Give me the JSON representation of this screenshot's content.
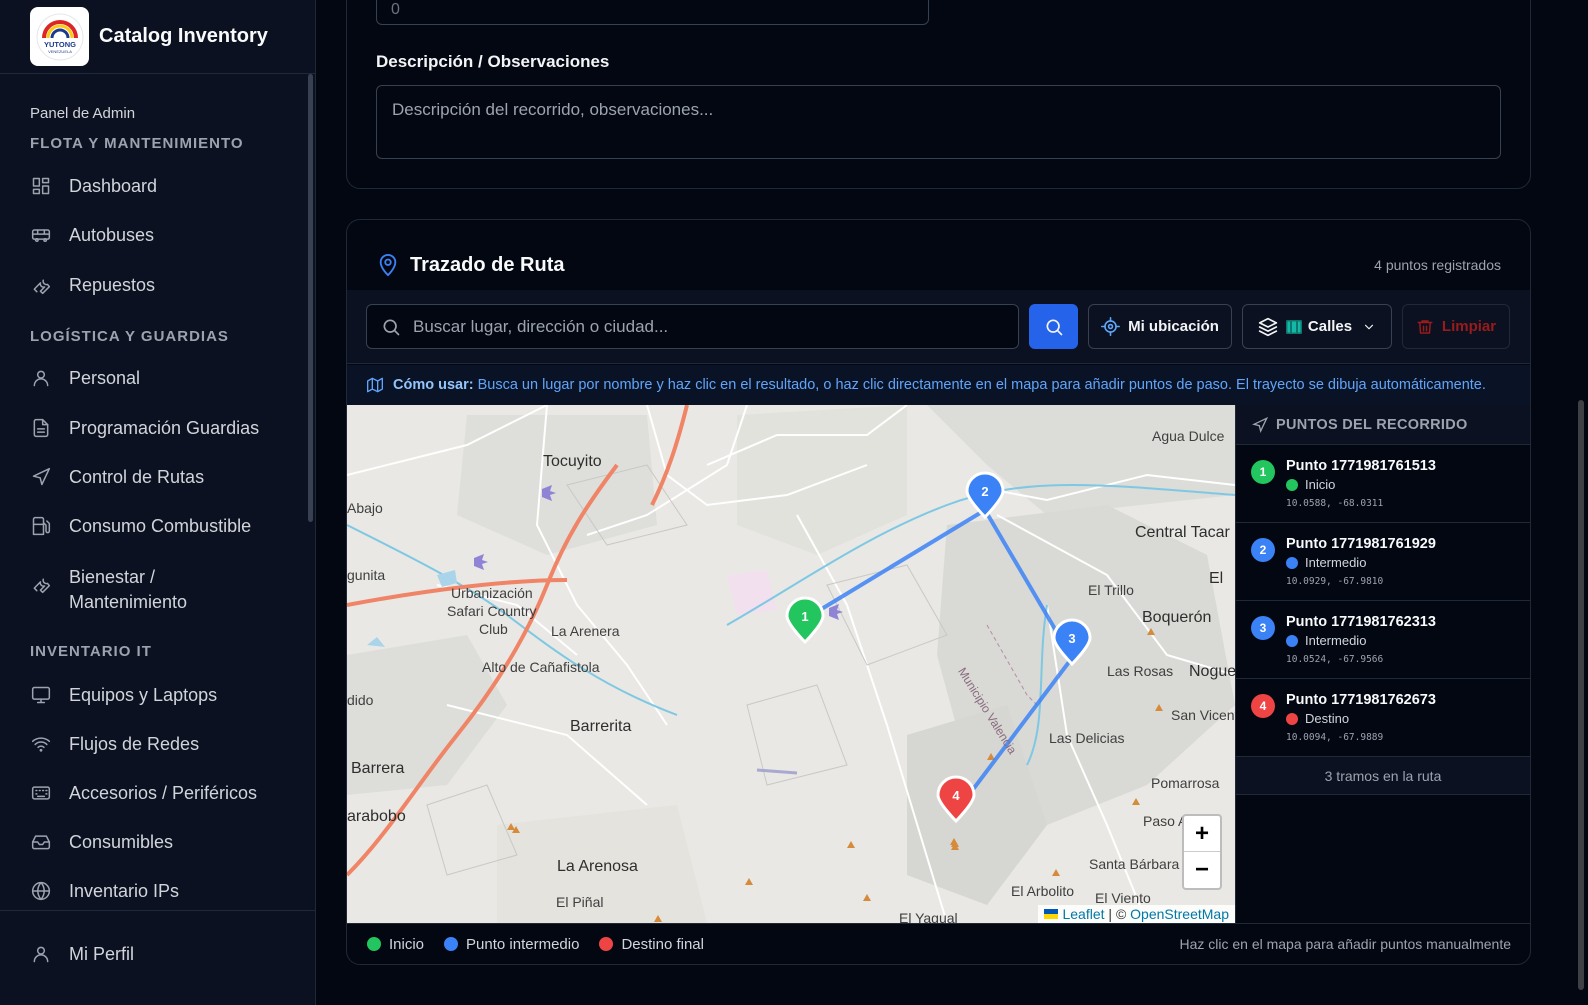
{
  "app": {
    "title": "Catalog Inventory",
    "logo_icon": "yutong-logo"
  },
  "sidebar": {
    "panel_label": "Panel de Admin",
    "sections": [
      {
        "label": "FLOTA Y MANTENIMIENTO",
        "items": [
          {
            "label": "Dashboard",
            "icon": "dashboard-icon"
          },
          {
            "label": "Autobuses",
            "icon": "bus-icon"
          },
          {
            "label": "Repuestos",
            "icon": "wrench-icon"
          }
        ]
      },
      {
        "label": "LOGÍSTICA Y GUARDIAS",
        "items": [
          {
            "label": "Personal",
            "icon": "user-icon"
          },
          {
            "label": "Programación Guardias",
            "icon": "document-icon"
          },
          {
            "label": "Control de Rutas",
            "icon": "navigation-icon"
          },
          {
            "label": "Consumo Combustible",
            "icon": "fuel-icon"
          },
          {
            "label": "Bienestar / Mantenimiento",
            "line1": "Bienestar /",
            "line2": "Mantenimiento",
            "icon": "wrench-icon"
          }
        ]
      },
      {
        "label": "INVENTARIO IT",
        "items": [
          {
            "label": "Equipos y Laptops",
            "icon": "monitor-icon"
          },
          {
            "label": "Flujos de Redes",
            "icon": "wifi-icon"
          },
          {
            "label": "Accesorios / Periféricos",
            "icon": "keyboard-icon"
          },
          {
            "label": "Consumibles",
            "icon": "inbox-icon"
          },
          {
            "label": "Inventario IPs",
            "icon": "globe-icon"
          }
        ]
      }
    ],
    "footer": {
      "label": "Mi Perfil",
      "icon": "user-icon"
    }
  },
  "form": {
    "top_input_value": "0",
    "description_label": "Descripción / Observaciones",
    "description_placeholder": "Descripción del recorrido, observaciones..."
  },
  "route": {
    "title": "Trazado de Ruta",
    "count_text": "4 puntos registrados",
    "search_placeholder": "Buscar lugar, dirección o ciudad...",
    "my_location_label": "Mi ubicación",
    "layer_label": "Calles",
    "clear_label": "Limpiar",
    "help_title": "Cómo usar:",
    "help_text": "Busca un lugar por nombre y haz clic en el resultado, o haz clic directamente en el mapa para añadir puntos de paso. El trayecto se dibuja automáticamente.",
    "points_header": "PUNTOS DEL RECORRIDO",
    "points": [
      {
        "num": "1",
        "name": "Punto 1771981761513",
        "role": "Inicio",
        "coords": "10.0588, -68.0311",
        "color": "#22c55e"
      },
      {
        "num": "2",
        "name": "Punto 1771981761929",
        "role": "Intermedio",
        "coords": "10.0929, -67.9810",
        "color": "#3b82f6"
      },
      {
        "num": "3",
        "name": "Punto 1771981762313",
        "role": "Intermedio",
        "coords": "10.0524, -67.9566",
        "color": "#3b82f6"
      },
      {
        "num": "4",
        "name": "Punto 1771981762673",
        "role": "Destino",
        "coords": "10.0094, -67.9889",
        "color": "#ef4444"
      }
    ],
    "segments_text": "3 tramos en la ruta",
    "legend": [
      {
        "label": "Inicio",
        "color": "#22c55e"
      },
      {
        "label": "Punto intermedio",
        "color": "#3b82f6"
      },
      {
        "label": "Destino final",
        "color": "#ef4444"
      }
    ],
    "legend_hint": "Haz clic en el mapa para añadir puntos manualmente",
    "attribution": {
      "leaflet": "Leaflet",
      "sep": " | © ",
      "osm": "OpenStreetMap"
    },
    "zoom_in": "+",
    "zoom_out": "−"
  },
  "map_places": [
    {
      "name": "Tocuyito",
      "big": true
    },
    {
      "name": "Abajo"
    },
    {
      "name": "gunita"
    },
    {
      "name": "Urbanización"
    },
    {
      "name": "Safari Country"
    },
    {
      "name": "Club"
    },
    {
      "name": "La Arenera"
    },
    {
      "name": "Alto de Cañafistola"
    },
    {
      "name": "dido"
    },
    {
      "name": "Barrerita",
      "big": true
    },
    {
      "name": "Barrera",
      "big": true
    },
    {
      "name": "arabobo",
      "big": true
    },
    {
      "name": "La Arenosa",
      "big": true
    },
    {
      "name": "El Piñal"
    },
    {
      "name": "El Yagual"
    },
    {
      "name": "Agua Dulce"
    },
    {
      "name": "Central Tacar",
      "big": true
    },
    {
      "name": "El"
    },
    {
      "name": "El Trillo"
    },
    {
      "name": "Boquerón",
      "big": true
    },
    {
      "name": "Nogue",
      "big": true
    },
    {
      "name": "Las Rosas"
    },
    {
      "name": "San Vicente"
    },
    {
      "name": "Las Delicias"
    },
    {
      "name": "Pomarrosa"
    },
    {
      "name": "Paso A"
    },
    {
      "name": "Santa Bárbara"
    },
    {
      "name": "El Arbolito"
    },
    {
      "name": "El Viento"
    },
    {
      "name": "Municipio Valencia"
    }
  ]
}
